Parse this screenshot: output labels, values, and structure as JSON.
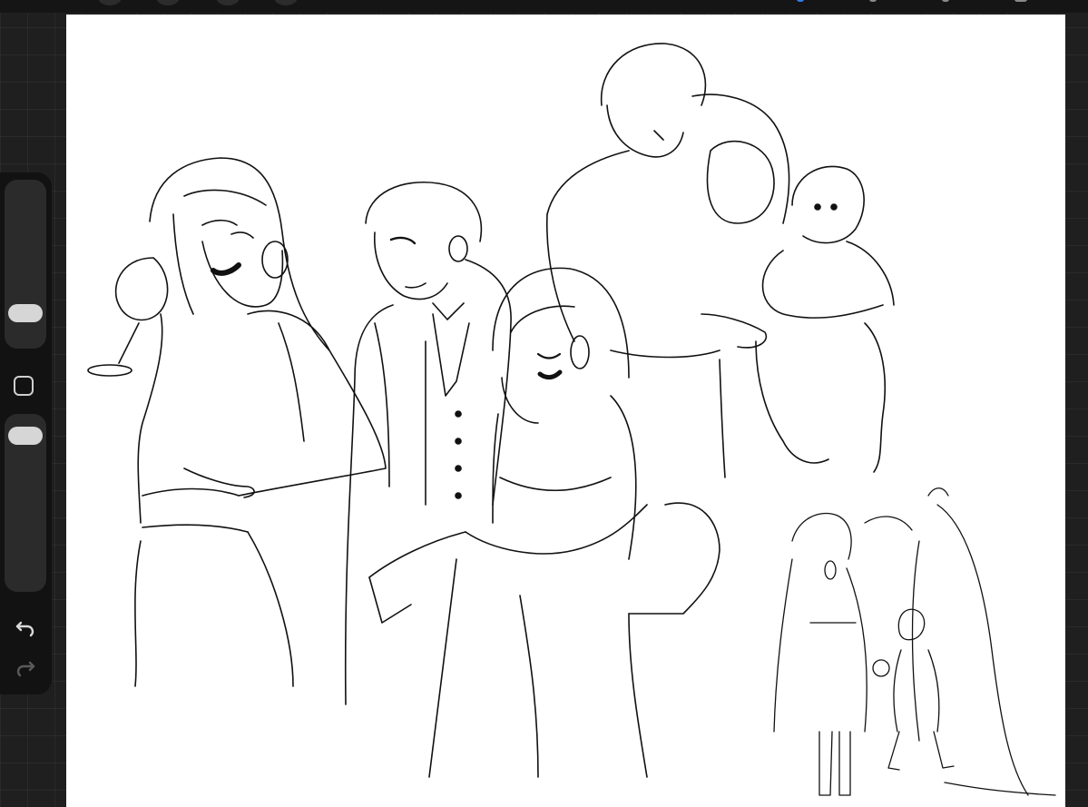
{
  "app": {
    "accent_color": "#2f7ff0",
    "canvas_color": "#ffffff",
    "background_color": "#1f1f1f"
  },
  "sidebar": {
    "brush_size": {
      "icon": "slider-thumb",
      "level": 0.13
    },
    "opacity": {
      "icon": "slider-thumb",
      "level": 0.94
    },
    "modify_icon": "square-icon",
    "undo_icon": "undo-arrow-icon",
    "redo_icon": "redo-arrow-icon"
  },
  "topbar": {
    "icons": [
      "gallery-icon",
      "actions-icon",
      "adjustments-icon",
      "selection-icon",
      "brush-icon",
      "smudge-icon",
      "eraser-icon",
      "layers-icon"
    ]
  }
}
